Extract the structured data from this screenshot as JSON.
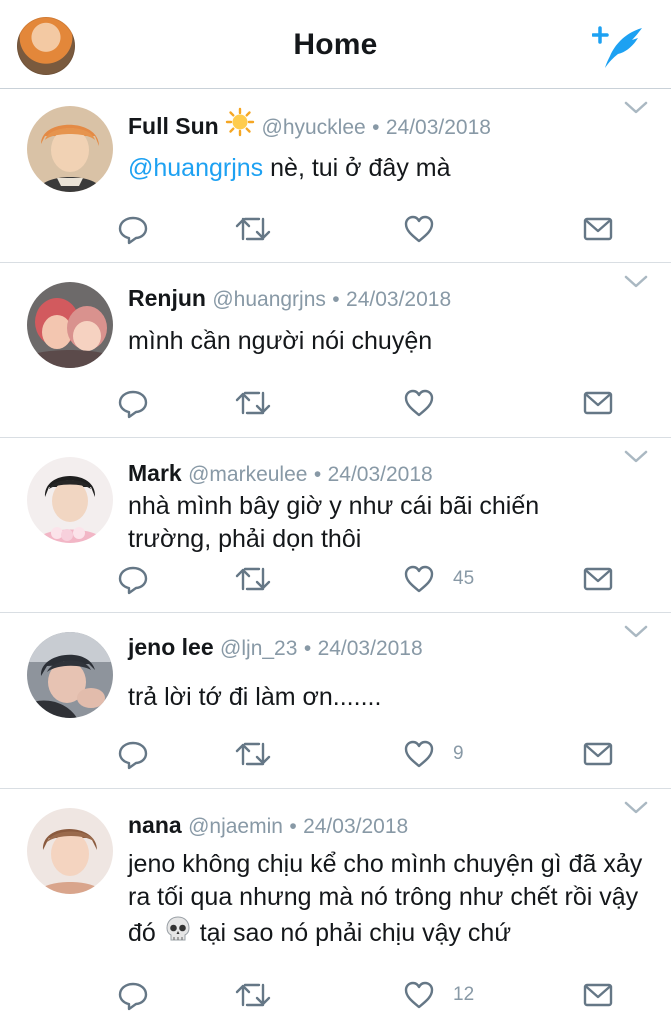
{
  "header": {
    "title": "Home"
  },
  "tweets": [
    {
      "name": "Full Sun",
      "name_emoji": "sun-emoji",
      "handle": "@hyucklee",
      "sep": "•",
      "date": "24/03/2018",
      "mention": "@huangrjns",
      "text": " nè, tui ở đây mà",
      "likes": "",
      "avatar_colors": [
        "#e48a45",
        "#f1d2b4",
        "#3a3a3a"
      ]
    },
    {
      "name": "Renjun",
      "handle": "@huangrjns",
      "sep": "•",
      "date": "24/03/2018",
      "text": "mình cần người nói chuyện",
      "likes": "",
      "avatar_colors": [
        "#d25a5e",
        "#f3c6b0",
        "#5b4a4a"
      ]
    },
    {
      "name": "Mark",
      "handle": "@markeulee",
      "sep": "•",
      "date": "24/03/2018",
      "text": "nhà mình bây giờ y như cái bãi chiến trường, phải dọn thôi",
      "likes": "45",
      "avatar_colors": [
        "#1f1f1f",
        "#f1d6c2",
        "#f2b6c6"
      ]
    },
    {
      "name": "jeno lee",
      "handle": "@ljn_23",
      "sep": "•",
      "date": "24/03/2018",
      "text": "trả lời tớ đi làm ơn.......",
      "likes": "9",
      "avatar_colors": [
        "#2b2f36",
        "#e7c3b3",
        "#8e949c"
      ]
    },
    {
      "name": "nana",
      "handle": "@njaemin",
      "sep": "•",
      "date": "24/03/2018",
      "text_a": "jeno không chịu kể cho mình chuyện gì đã xảy ra tối qua nhưng mà nó trông như chết rồi vậy đó ",
      "text_b": " tại sao nó phải chịu vậy chứ",
      "text_emoji": "skull-emoji",
      "likes": "12",
      "avatar_colors": [
        "#8a5a3e",
        "#f4d4c0",
        "#d9a58c"
      ]
    }
  ],
  "colors": {
    "accent": "#1da1f2",
    "meta": "#8899a6",
    "icon": "#657786",
    "divider": "#d9dee3"
  },
  "icons": [
    "reply-icon",
    "retweet-icon",
    "like-icon",
    "message-icon",
    "chevron-down-icon",
    "compose-icon"
  ]
}
